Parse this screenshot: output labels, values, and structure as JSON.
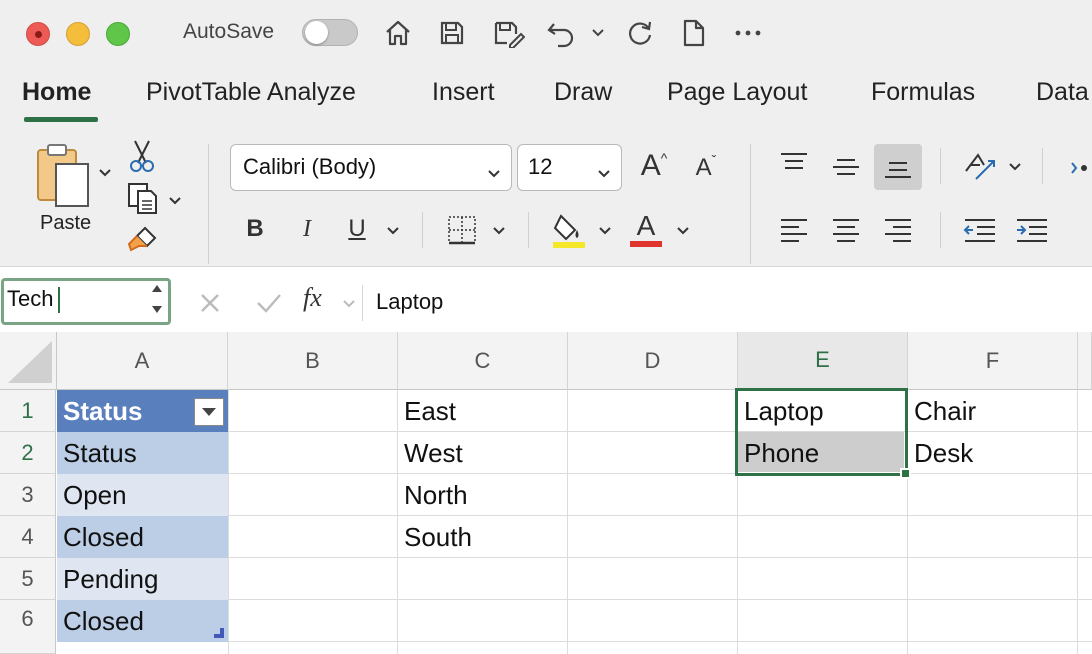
{
  "titlebar": {
    "autosave_label": "AutoSave",
    "autosave_state": "off"
  },
  "ribbon": {
    "tabs": [
      {
        "label": "Home",
        "active": true
      },
      {
        "label": "PivotTable Analyze",
        "active": false
      },
      {
        "label": "Insert",
        "active": false
      },
      {
        "label": "Draw",
        "active": false
      },
      {
        "label": "Page Layout",
        "active": false
      },
      {
        "label": "Formulas",
        "active": false
      },
      {
        "label": "Data",
        "active": false
      }
    ],
    "clipboard": {
      "paste_label": "Paste"
    },
    "font": {
      "name": "Calibri (Body)",
      "size": "12",
      "bold_label": "B",
      "italic_label": "I",
      "underline_label": "U",
      "font_color_label": "A",
      "grow_label": "A",
      "shrink_label": "A"
    },
    "colors": {
      "accent": "#2e7147",
      "highlight": "#f5e82a",
      "font_color": "#e0352f"
    }
  },
  "formula_bar": {
    "name_box_value": "Tech",
    "fx_label": "fx",
    "formula_value": "Laptop"
  },
  "sheet": {
    "columns": [
      "A",
      "B",
      "C",
      "D",
      "E",
      "F"
    ],
    "rows": [
      "1",
      "2",
      "3",
      "4",
      "5",
      "6"
    ],
    "selected_column": "E",
    "cells": {
      "A1": "Status",
      "A2": "Status",
      "A3": "Open",
      "A4": "Closed",
      "A5": "Pending",
      "A6": "Closed",
      "C1": "East",
      "C2": "West",
      "C3": "North",
      "C4": "South",
      "E1": "Laptop",
      "E2": "Phone",
      "F1": "Chair",
      "F2": "Desk"
    },
    "table_colors": {
      "header": "#5a7fbd",
      "band_dark": "#bccde6",
      "band_light": "#dfe6f1"
    }
  }
}
